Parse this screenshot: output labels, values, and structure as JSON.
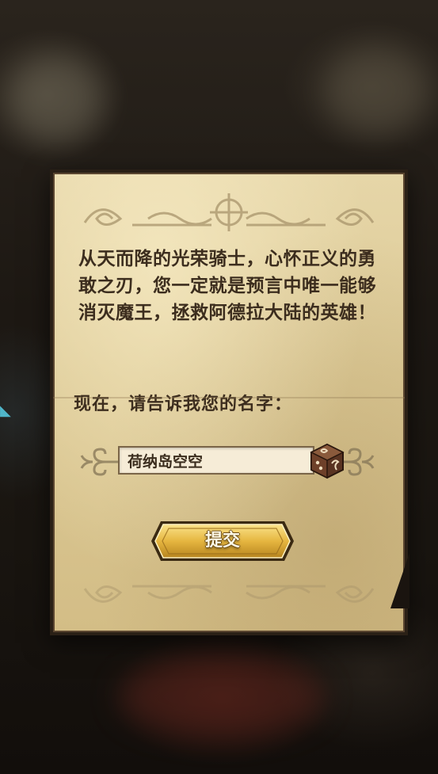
{
  "dialog": {
    "story_text": "从天而降的光荣骑士，心怀正义的勇敢之刃，您一定就是预言中唯一能够消灭魔王，拯救阿德拉大陆的英雄！",
    "prompt_text": "现在，请告诉我您的名字：",
    "name_input_value": "荷纳岛空空",
    "submit_label": "提交"
  },
  "icons": {
    "dice": "dice-icon",
    "corner_ornament": "ornament-icon",
    "swirl": "swirl-icon"
  },
  "colors": {
    "parchment": "#dcc995",
    "ink": "#3c2d1e",
    "button_gold": "#e6b640",
    "frame_dark": "#2a2016",
    "background": "#191510"
  }
}
